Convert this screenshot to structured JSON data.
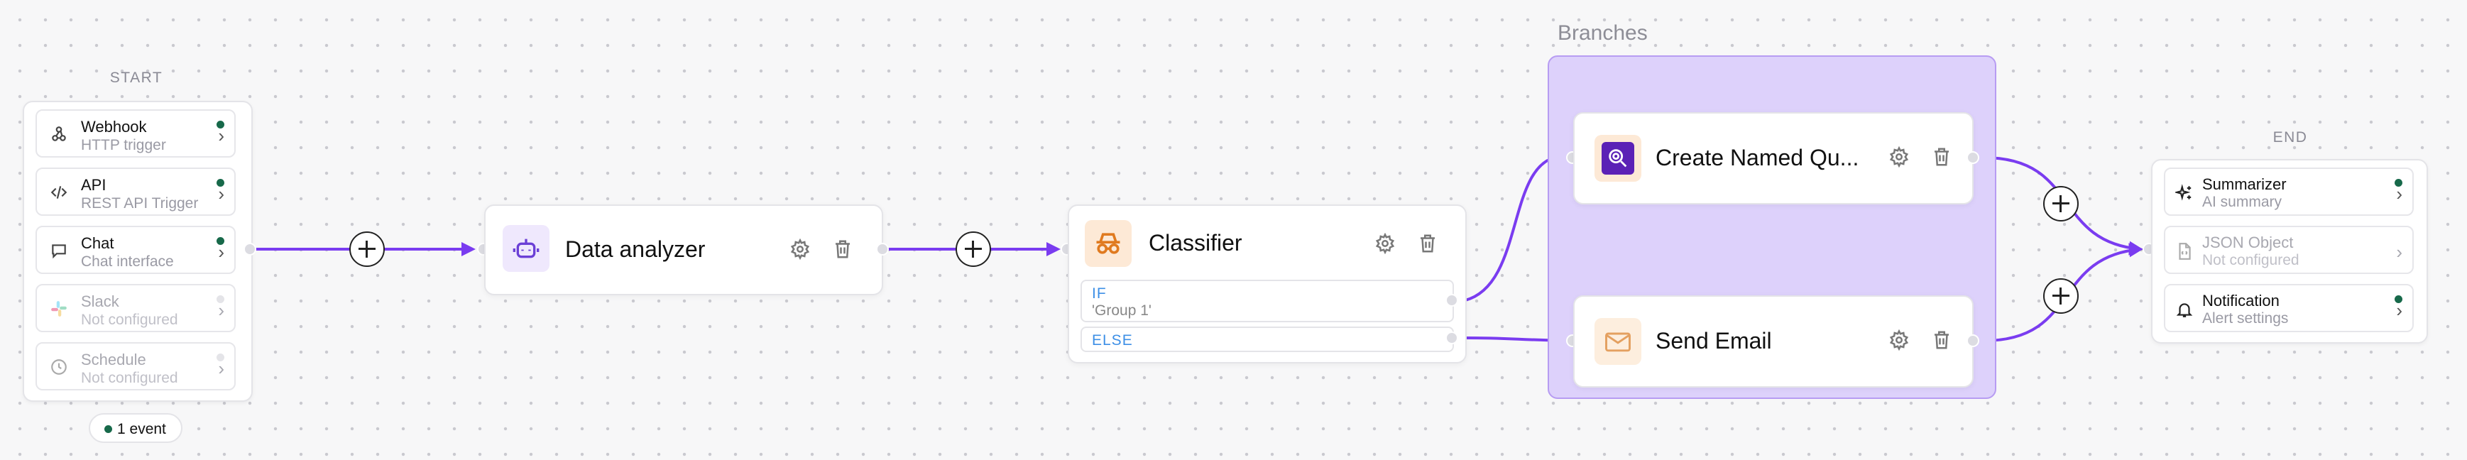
{
  "start": {
    "label": "START",
    "triggers": [
      {
        "name": "Webhook",
        "sub": "HTTP trigger",
        "icon": "webhook-icon",
        "active": true
      },
      {
        "name": "API",
        "sub": "REST API Trigger",
        "icon": "code-icon",
        "active": true
      },
      {
        "name": "Chat",
        "sub": "Chat interface",
        "icon": "chat-bubble-icon",
        "active": true
      },
      {
        "name": "Slack",
        "sub": "Not configured",
        "icon": "slack-icon",
        "active": false
      },
      {
        "name": "Schedule",
        "sub": "Not configured",
        "icon": "clock-icon",
        "active": false
      }
    ],
    "event_badge": "1 event"
  },
  "nodes": {
    "data_analyzer": {
      "title": "Data analyzer",
      "icon": "robot-icon"
    },
    "classifier": {
      "title": "Classifier",
      "icon": "spy-icon",
      "if_label": "IF",
      "if_value": "'Group 1'",
      "else_label": "ELSE"
    },
    "create_named_query": {
      "title": "Create Named Qu...",
      "icon": "search-query-icon"
    },
    "send_email": {
      "title": "Send Email",
      "icon": "envelope-icon"
    }
  },
  "branches_label": "Branches",
  "end": {
    "label": "END",
    "outputs": [
      {
        "name": "Summarizer",
        "sub": "AI summary",
        "icon": "sparkles-icon",
        "active": true
      },
      {
        "name": "JSON Object",
        "sub": "Not configured",
        "icon": "json-file-icon",
        "active": false
      },
      {
        "name": "Notification",
        "sub": "Alert settings",
        "icon": "bell-icon",
        "active": true
      }
    ]
  },
  "colors": {
    "edge": "#7a3cf0",
    "branch_fill": "#ddd1fb",
    "active_dot": "#17694a",
    "condition_keyword": "#3d8fe6"
  }
}
